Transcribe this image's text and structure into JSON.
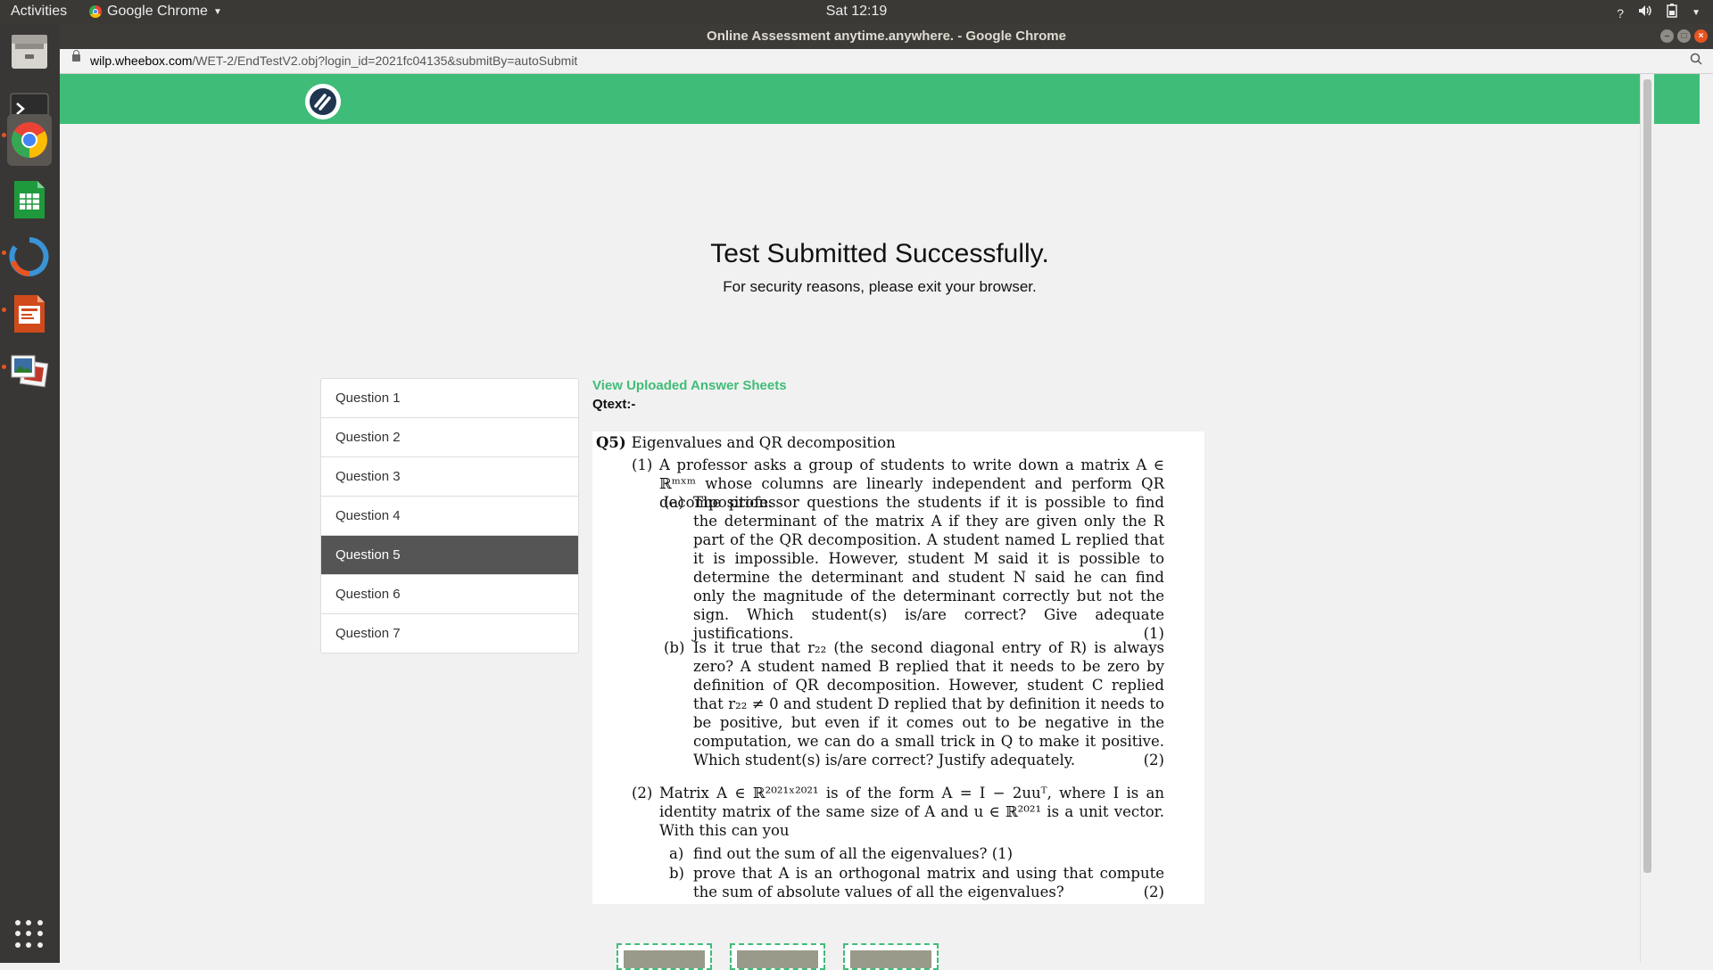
{
  "topbar": {
    "activities": "Activities",
    "app_menu": "Google Chrome",
    "clock": "Sat 12:19"
  },
  "window": {
    "title": "Online Assessment anytime.anywhere. - Google Chrome"
  },
  "address": {
    "host": "wilp.wheebox.com",
    "path": "/WET-2/EndTestV2.obj?login_id=2021fc04135&submitBy=autoSubmit"
  },
  "dock": {
    "apps": [
      "files-icon",
      "terminal-icon",
      "chrome-icon",
      "spreadsheet-icon",
      "software-updater-icon",
      "presentation-icon",
      "image-viewer-icon"
    ]
  },
  "banner": {
    "title": "Test Submitted Successfully.",
    "subtitle": "For security reasons, please exit your browser."
  },
  "questions": [
    "Question 1",
    "Question 2",
    "Question 3",
    "Question 4",
    "Question 5",
    "Question 6",
    "Question 7"
  ],
  "active_question": "Question 5",
  "main": {
    "view_link": "View Uploaded Answer Sheets",
    "qtext_label": "Qtext:-"
  },
  "qpaper": {
    "q_num": "Q5)",
    "q_title": "Eigenvalues and QR decomposition",
    "p1_num": "(1)",
    "p1_text": "A professor asks a group of students to write down a matrix A ∈ ℝᵐˣᵐ whose columns are linearly independent and perform QR decomposition.",
    "pa_num": "(a)",
    "pa_text": "The professor questions the students if it is possible to find the determinant of the matrix A if they are given only the R part of the QR decomposition. A student named L replied that it is impossible. However, student M said it is possible to determine the determinant and student N said he can find only the magnitude of the determinant correctly but not the sign.  Which student(s) is/are correct? Give adequate justifications.",
    "pa_mark": "(1)",
    "pb_num": "(b)",
    "pb_text": "Is it true that r₂₂ (the second diagonal entry of R) is always zero? A student named B replied that it needs to be zero by definition of QR decomposition. However, student C replied that r₂₂ ≠ 0 and student D replied that by definition it needs to be positive, but even if it comes out to be negative in the computation, we can do a small trick in Q to make it positive.  Which student(s) is/are correct?  Justify adequately.",
    "pb_mark": "(2)",
    "p2_num": "(2)",
    "p2_text": "Matrix A ∈ ℝ²⁰²¹ˣ²⁰²¹ is of the form A = I − 2uuᵀ, where I is an identity matrix of the same size of A and u ∈ ℝ²⁰²¹ is a unit vector.  With this can you",
    "sa_num": "a)",
    "sa_text": "find out the sum of all the eigenvalues? (1)",
    "sb_num": "b)",
    "sb_text": "prove that A is an orthogonal matrix and using that compute the sum of absolute values of all the eigenvalues?",
    "sb_mark": "(2)"
  }
}
